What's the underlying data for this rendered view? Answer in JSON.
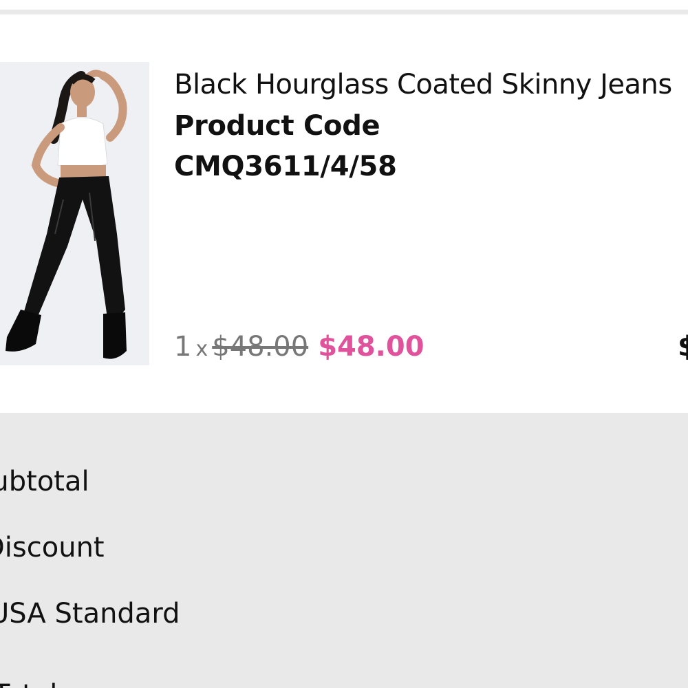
{
  "product": {
    "title": "Black Hourglass Coated Skinny Jeans",
    "code_label": "Product Code",
    "code_value": "CMQ3611/4/58",
    "quantity": "1",
    "times": "x",
    "original_price": "$48.00",
    "sale_price": "$48.00",
    "line_total_partial": "$",
    "colors": {
      "sale": "#e0529c",
      "muted": "#777777"
    }
  },
  "summary": {
    "subtotal_label": "Subtotal",
    "discount_label": "Discount",
    "shipping_label": "USA Standard",
    "total_label": "Total"
  }
}
